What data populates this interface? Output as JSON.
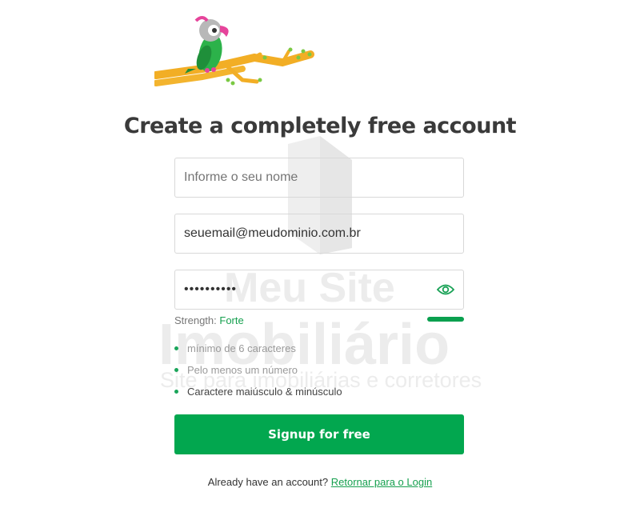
{
  "watermark": {
    "line1": "Meu Site",
    "line2": "Imobiliário",
    "line3": "Site para imobiliárias e corretores"
  },
  "page": {
    "title": "Create a completely free account"
  },
  "form": {
    "name_placeholder": "Informe o seu nome",
    "email_value": "seuemail@meudominio.com.br",
    "password_value": "mysecret12",
    "strength_label": "Strength:",
    "strength_value": "Forte",
    "strength_level": 1.0,
    "requirements": [
      {
        "text": "mínimo de 6 caracteres",
        "state": "muted"
      },
      {
        "text": "Pelo menos um número",
        "state": "muted"
      },
      {
        "text": "Caractere maiúsculo & minúsculo",
        "state": "ok"
      }
    ],
    "submit_label": "Signup for free"
  },
  "footer": {
    "text": "Already have an account?",
    "link_label": "Retornar para o Login"
  },
  "colors": {
    "accent": "#02a74f",
    "link": "#16a04f"
  }
}
